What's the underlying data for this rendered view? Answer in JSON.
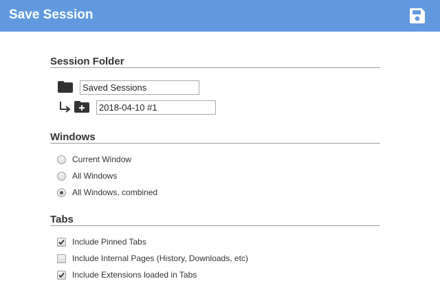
{
  "header": {
    "title": "Save Session",
    "save_icon": "floppy-disk-icon",
    "background": "#6199df"
  },
  "session_folder": {
    "title": "Session Folder",
    "folder_icon": "folder-icon",
    "folder_value": "Saved Sessions",
    "subfolder_arrow_icon": "arrow-turn-down-right-icon",
    "new_folder_icon": "folder-plus-icon",
    "session_name_value": "2018-04-10 #1"
  },
  "windows": {
    "title": "Windows",
    "options": [
      {
        "label": "Current Window",
        "checked": false
      },
      {
        "label": "All Windows",
        "checked": false
      },
      {
        "label": "All Windows, combined",
        "checked": true
      }
    ]
  },
  "tabs": {
    "title": "Tabs",
    "options": [
      {
        "label": "Include Pinned Tabs",
        "checked": true
      },
      {
        "label": "Include Internal Pages (History, Downloads, etc)",
        "checked": false
      },
      {
        "label": "Include Extensions loaded in Tabs",
        "checked": true
      }
    ]
  }
}
